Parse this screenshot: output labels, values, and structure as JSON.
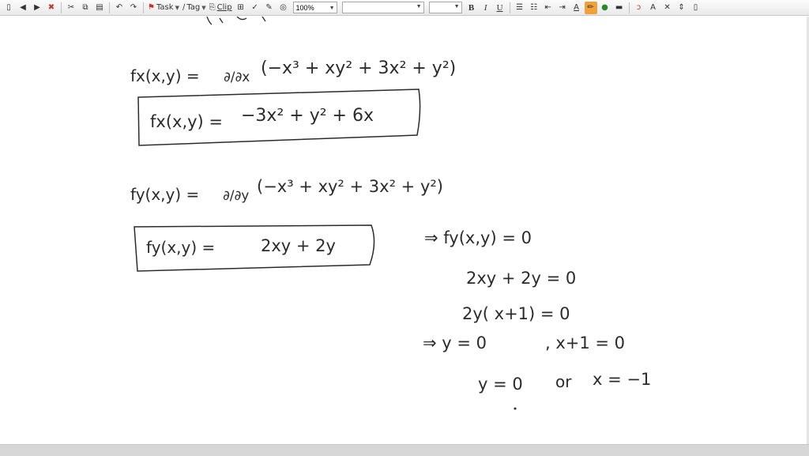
{
  "toolbar": {
    "task_label": "Task",
    "tag_label": "Tag",
    "clip_label": "Clip",
    "zoom_value": "100%",
    "bold_label": "B",
    "italic_label": "I",
    "underline_label": "U",
    "font_color_label": "A",
    "small_caps_label": "A",
    "icons": [
      "new-page",
      "back",
      "forward",
      "delete",
      "cut",
      "copy",
      "paste",
      "undo",
      "redo",
      "task-flag",
      "tag",
      "clip",
      "table",
      "spellcheck",
      "pen",
      "circle",
      "bullets",
      "numbering",
      "outdent",
      "indent",
      "font-color",
      "highlighter",
      "fill-color",
      "line-style",
      "lasso",
      "font-size",
      "close",
      "insert-space"
    ]
  },
  "note": {
    "line1_lhs": "fx(x,y) =",
    "line1_op": "∂/∂x",
    "line1_rhs": "(−x³ + xy² + 3x² + y²)",
    "line2_lhs": "fx(x,y) =",
    "line2_rhs": "−3x² + y² + 6x",
    "line3_lhs": "fy(x,y) =",
    "line3_op": "∂/∂y",
    "line3_rhs": "(−x³ + xy² + 3x² + y²)",
    "line4_lhs": "fy(x,y) =",
    "line4_rhs": "2xy + 2y",
    "step1": "⇒ fy(x,y) = 0",
    "step2": "2xy + 2y = 0",
    "step3": "2y( x+1) = 0",
    "step4_a": "⇒  y = 0",
    "step4_b": ", x+1 = 0",
    "step5_a": "y = 0",
    "step5_b": "or",
    "step5_c": "x = −1"
  },
  "colors": {
    "ink": "#2b2b2b",
    "highlight": "#f0a13a",
    "toolbar_bg": "#efefef"
  }
}
